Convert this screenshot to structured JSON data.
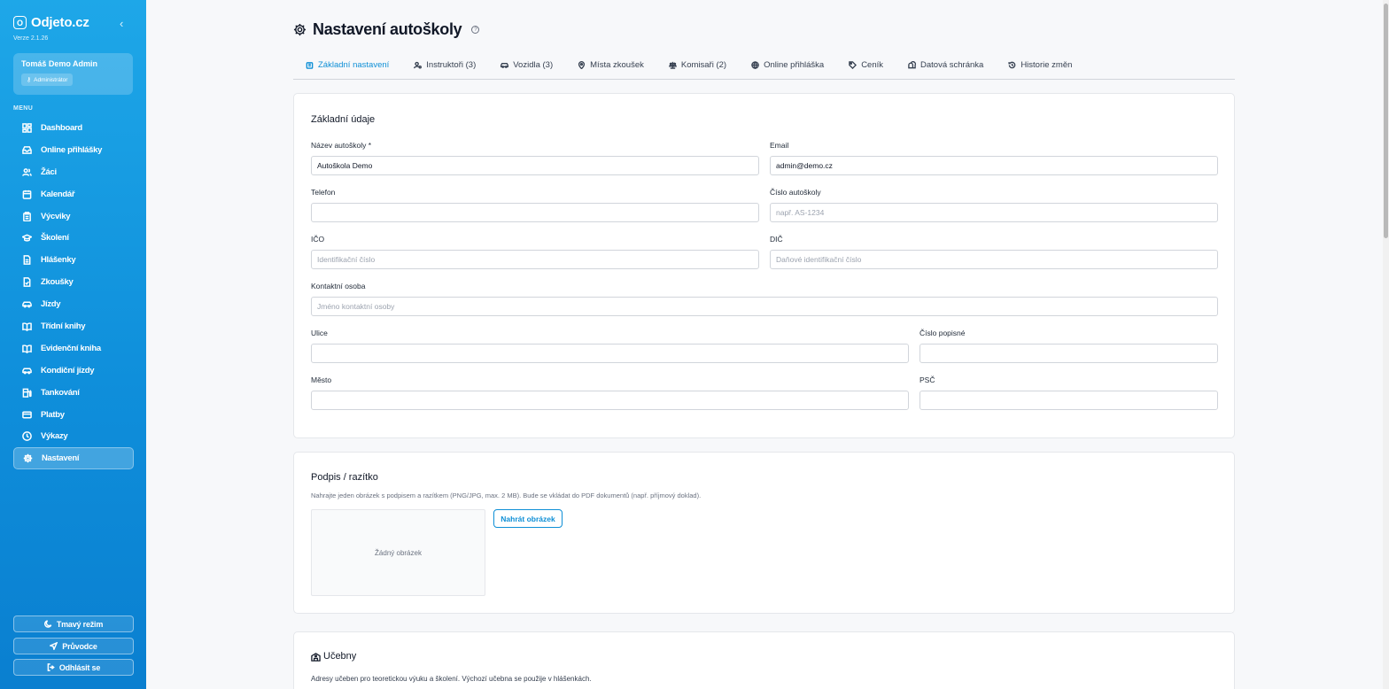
{
  "sidebar": {
    "brand_logo_letter": "O",
    "brand_name": "Odjeto.cz",
    "version": "Verze 2.1.26",
    "user": {
      "name": "Tomáš Demo Admin",
      "role": "Administrátor"
    },
    "menu_label": "MENU",
    "items": [
      {
        "label": "Dashboard",
        "icon": "dashboard-icon"
      },
      {
        "label": "Online přihlášky",
        "icon": "inbox-icon"
      },
      {
        "label": "Žáci",
        "icon": "users-icon"
      },
      {
        "label": "Kalendář",
        "icon": "calendar-icon"
      },
      {
        "label": "Výcviky",
        "icon": "clipboard-icon"
      },
      {
        "label": "Školení",
        "icon": "graduation-cap-icon"
      },
      {
        "label": "Hlášenky",
        "icon": "document-icon"
      },
      {
        "label": "Zkoušky",
        "icon": "file-check-icon"
      },
      {
        "label": "Jízdy",
        "icon": "car-icon"
      },
      {
        "label": "Třídní knihy",
        "icon": "book-open-icon"
      },
      {
        "label": "Evidenční kniha",
        "icon": "book-icon"
      },
      {
        "label": "Kondiční jízdy",
        "icon": "car-icon"
      },
      {
        "label": "Tankování",
        "icon": "fuel-icon"
      },
      {
        "label": "Platby",
        "icon": "credit-card-icon"
      },
      {
        "label": "Výkazy",
        "icon": "clock-icon"
      },
      {
        "label": "Nastavení",
        "icon": "gear-icon"
      }
    ],
    "active_index": 15,
    "dark_mode": "Tmavý režim",
    "guide": "Průvodce",
    "logout": "Odhlásit se"
  },
  "page": {
    "title": "Nastavení autoškoly",
    "tabs": [
      {
        "label": "Základní nastavení",
        "icon": "building-icon"
      },
      {
        "label": "Instruktoři (3)",
        "icon": "user-cog-icon"
      },
      {
        "label": "Vozidla (3)",
        "icon": "car-icon"
      },
      {
        "label": "Místa zkoušek",
        "icon": "map-pin-icon"
      },
      {
        "label": "Komisaři (2)",
        "icon": "scale-icon"
      },
      {
        "label": "Online přihláška",
        "icon": "globe-icon"
      },
      {
        "label": "Ceník",
        "icon": "tag-icon"
      },
      {
        "label": "Datová schránka",
        "icon": "mailbox-icon"
      },
      {
        "label": "Historie změn",
        "icon": "history-icon"
      }
    ],
    "active_tab": 0
  },
  "basic": {
    "title": "Základní údaje",
    "name_label": "Název autoškoly *",
    "name_value": "Autoškola Demo",
    "email_label": "Email",
    "email_value": "admin@demo.cz",
    "phone_label": "Telefon",
    "phone_value": "",
    "number_label": "Číslo autoškoly",
    "number_placeholder": "např. AS-1234",
    "ico_label": "IČO",
    "ico_placeholder": "Identifikační číslo",
    "dic_label": "DIČ",
    "dic_placeholder": "Daňové identifikační číslo",
    "contact_label": "Kontaktní osoba",
    "contact_placeholder": "Jméno kontaktní osoby",
    "street_label": "Ulice",
    "street_value": "",
    "house_label": "Číslo popisné",
    "house_value": "",
    "city_label": "Město",
    "city_value": "",
    "zip_label": "PSČ",
    "zip_value": ""
  },
  "signature": {
    "title": "Podpis / razítko",
    "description": "Nahrajte jeden obrázek s podpisem a razítkem (PNG/JPG, max. 2 MB). Bude se vkládat do PDF dokumentů (např. příjmový doklad).",
    "empty": "Žádný obrázek",
    "upload": "Nahrát obrázek"
  },
  "classrooms": {
    "title": "Učebny",
    "description": "Adresy učeben pro teoretickou výuku a školení. Výchozí učebna se použije v hlášenkách."
  },
  "colors": {
    "accent": "#0e8fd6",
    "sidebar_top": "#1ea7e8",
    "sidebar_bottom": "#0a7fd0"
  }
}
